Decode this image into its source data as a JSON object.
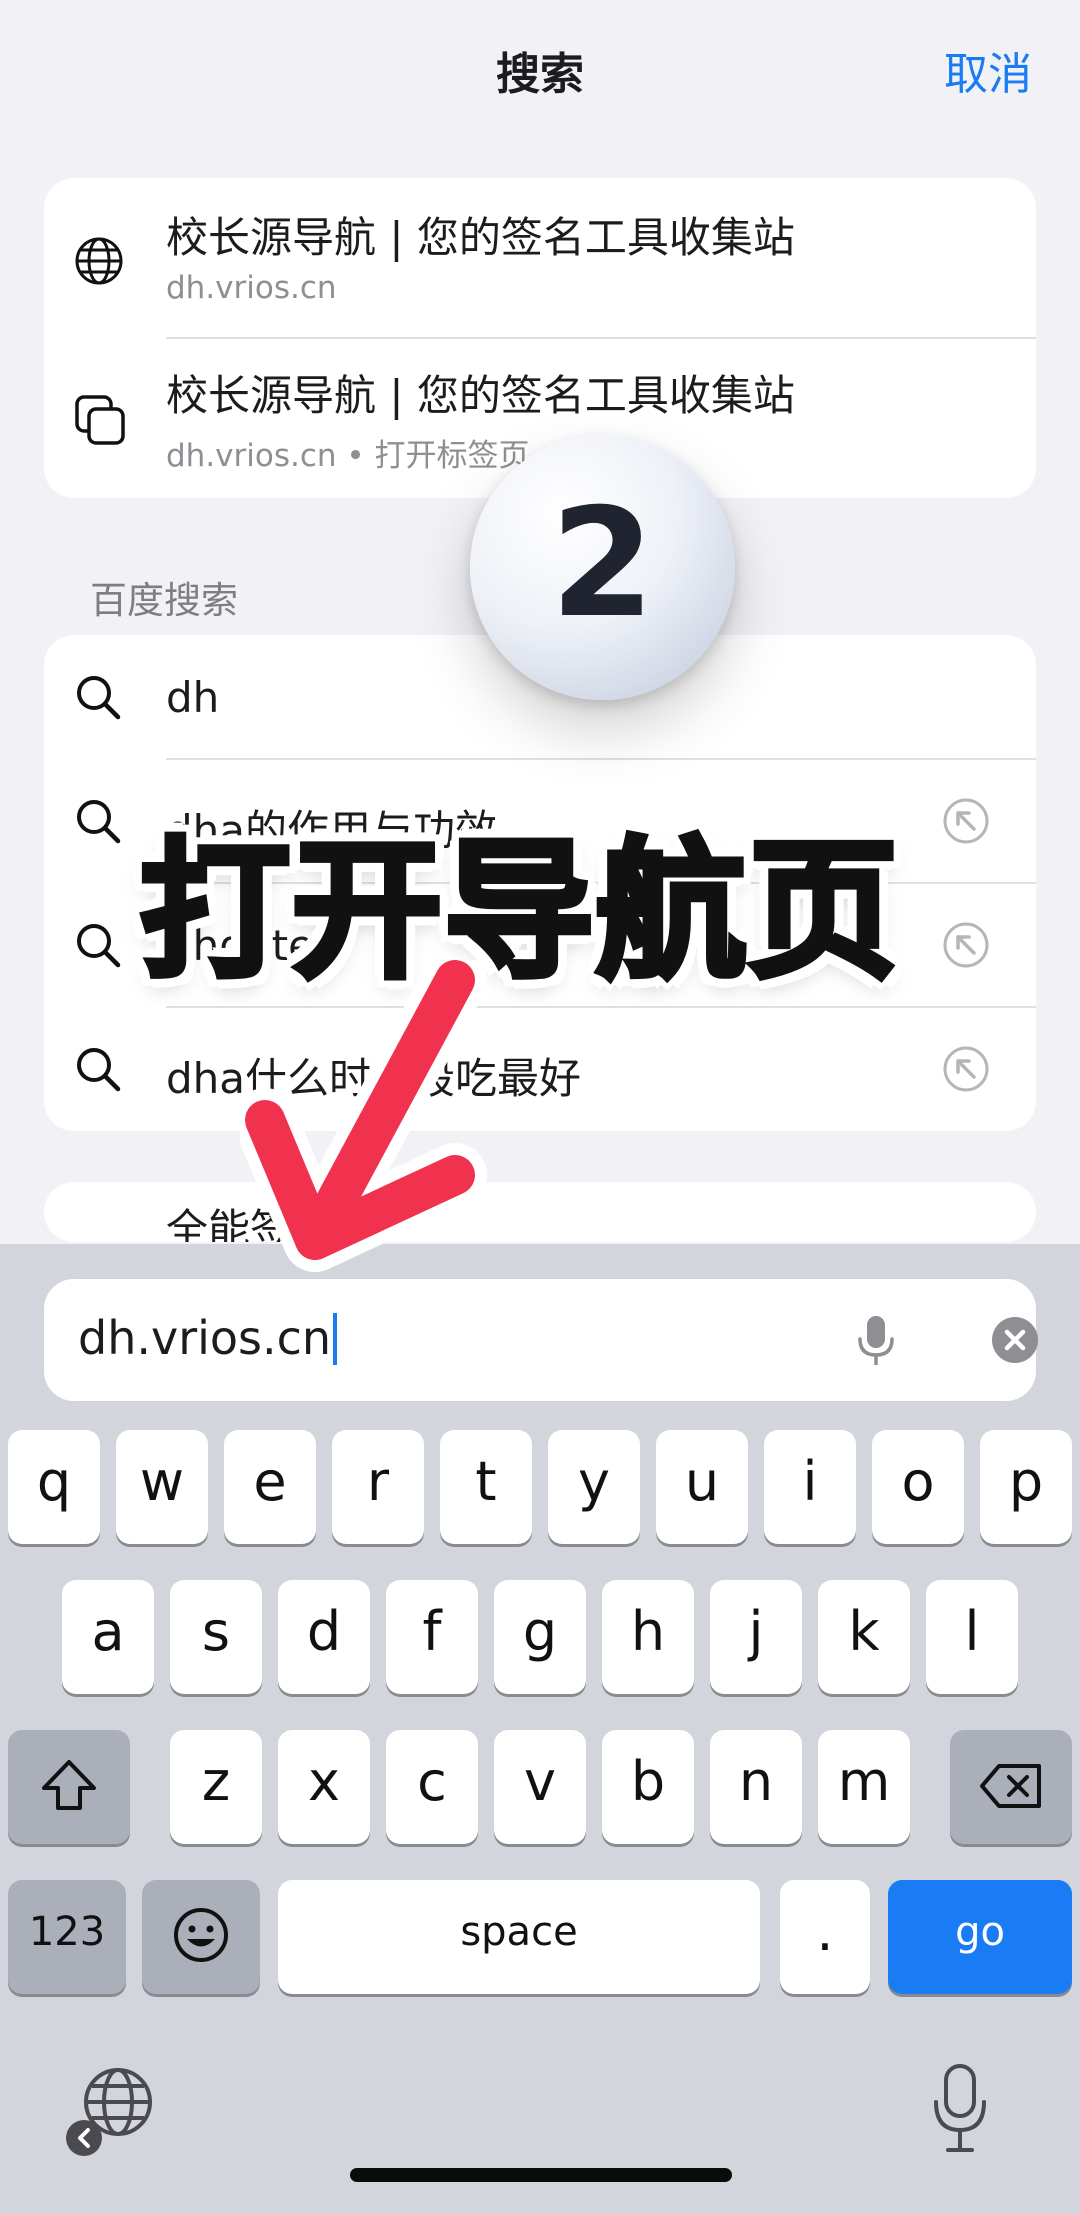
{
  "header": {
    "title": "搜索",
    "cancel": "取消"
  },
  "top_results": [
    {
      "title": "校长源导航 | 您的签名工具收集站",
      "subtitle": "dh.vrios.cn",
      "icon": "globe-icon"
    },
    {
      "title": "校长源导航 | 您的签名工具收集站",
      "subtitle": "dh.vrios.cn • 打开标签页",
      "icon": "tabs-icon"
    }
  ],
  "section_label": "百度搜索",
  "search_suggestions": [
    {
      "text": "dh"
    },
    {
      "text": "dha的作用与功效"
    },
    {
      "text": "dhgate"
    },
    {
      "text": "dha什么时间段吃最好"
    }
  ],
  "partial_row_text": "全能签",
  "url_bar": {
    "value": "dh.vrios.cn"
  },
  "overlay": {
    "badge_number": "2",
    "caption": "打开导航页"
  },
  "keyboard": {
    "row1": [
      "q",
      "w",
      "e",
      "r",
      "t",
      "y",
      "u",
      "i",
      "o",
      "p"
    ],
    "row2": [
      "a",
      "s",
      "d",
      "f",
      "g",
      "h",
      "j",
      "k",
      "l"
    ],
    "row3": [
      "z",
      "x",
      "c",
      "v",
      "b",
      "n",
      "m"
    ],
    "numbers_key": "123",
    "space_key": "space",
    "period_key": ".",
    "go_key": "go"
  },
  "colors": {
    "accent": "#1a7cf5",
    "arrow": "#f0324f",
    "background": "#f2f2f6",
    "keyboard_bg": "#d3d5dc"
  }
}
